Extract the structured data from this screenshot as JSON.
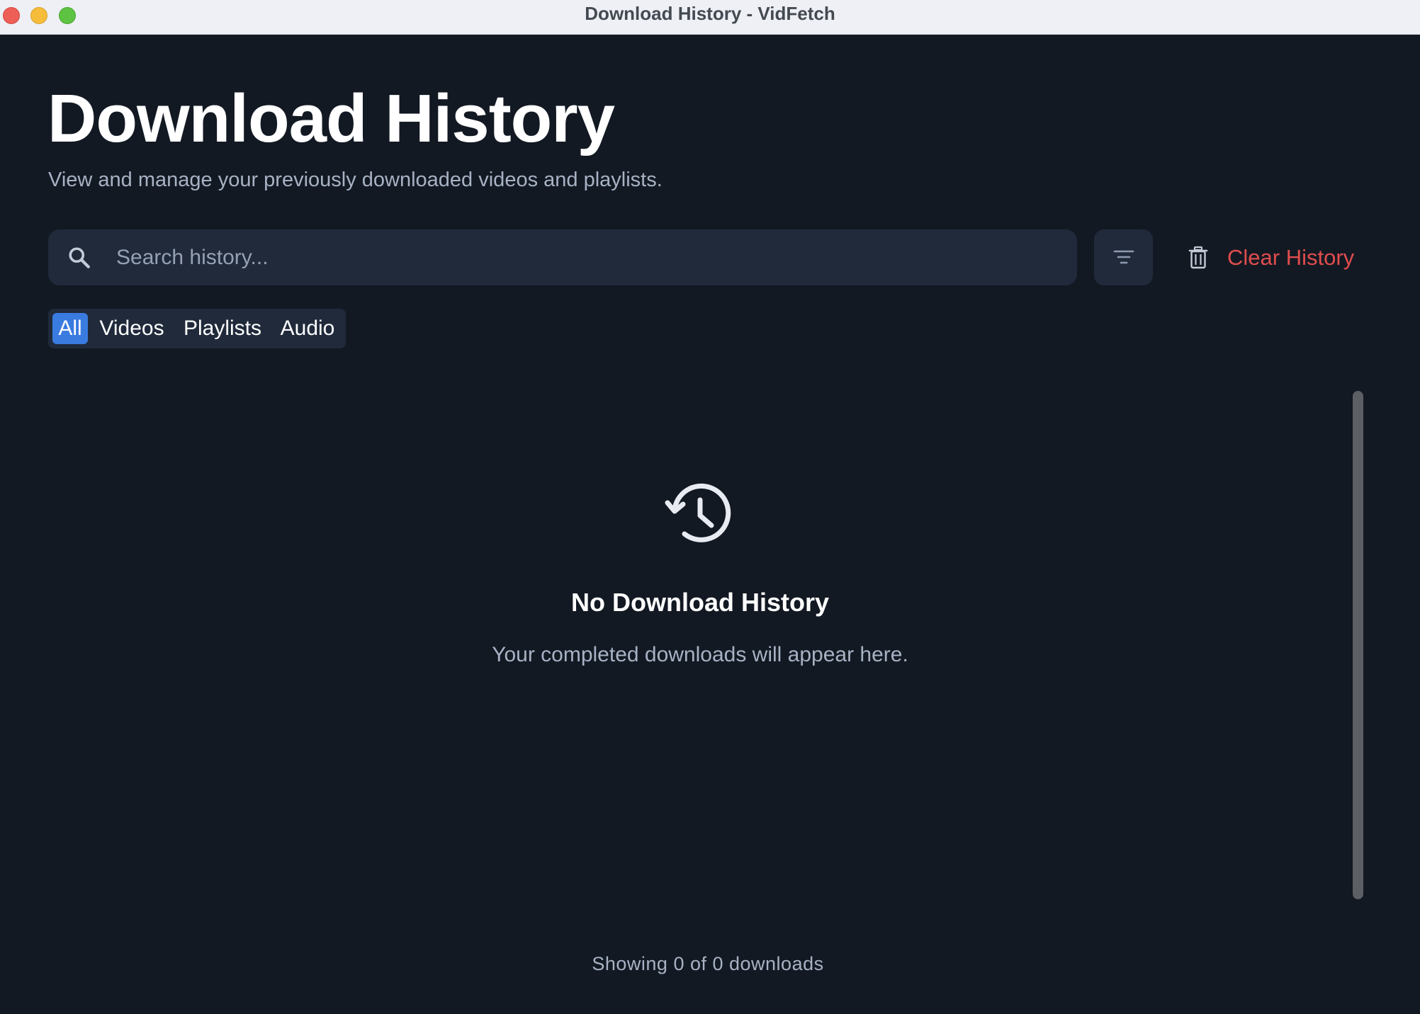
{
  "window": {
    "title": "Download History - VidFetch"
  },
  "header": {
    "title": "Download History",
    "subtitle": "View and manage your previously downloaded videos and playlists."
  },
  "toolbar": {
    "search_placeholder": "Search history...",
    "search_value": "",
    "search_icon": "search-icon",
    "filter_icon": "filter-icon",
    "clear_label": "Clear History",
    "clear_icon": "trash-icon"
  },
  "tabs": [
    {
      "label": "All",
      "active": true
    },
    {
      "label": "Videos",
      "active": false
    },
    {
      "label": "Playlists",
      "active": false
    },
    {
      "label": "Audio",
      "active": false
    }
  ],
  "empty_state": {
    "icon": "history-icon",
    "title": "No Download History",
    "subtitle": "Your completed downloads will appear here."
  },
  "footer": {
    "count_text": "Showing 0 of 0 downloads"
  },
  "colors": {
    "background": "#131923",
    "surface": "#202a3b",
    "accent": "#3a7be0",
    "danger": "#e14d4d",
    "muted_text": "#a7b2c4"
  }
}
